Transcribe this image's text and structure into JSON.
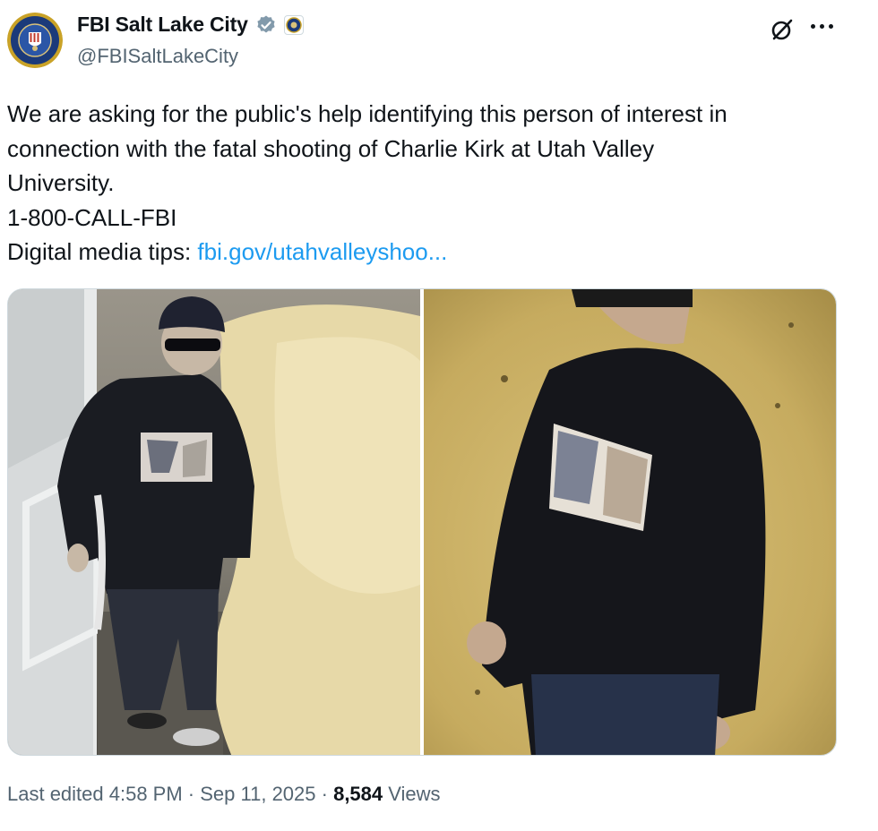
{
  "author": {
    "display_name": "FBI Salt Lake City",
    "handle": "@FBISaltLakeCity",
    "avatar_icon": "fbi-seal-icon",
    "verified_icon": "verified-badge-icon",
    "affiliation_icon": "fbi-affiliate-badge-icon"
  },
  "actions": {
    "grok_icon": "grok-icon",
    "more_icon": "more-options-icon"
  },
  "tweet": {
    "text_lines": [
      "We are asking for the public's help identifying this person of interest in",
      "connection with the fatal shooting of Charlie Kirk at Utah Valley",
      "University.",
      "1-800-CALL-FBI"
    ],
    "tips_prefix": "Digital media tips: ",
    "tips_link": "fbi.gov/utahvalleyshoo..."
  },
  "media": {
    "photos": [
      "surveillance-photo-stairwell",
      "surveillance-photo-hallway"
    ]
  },
  "footer": {
    "edited": "Last edited 4:58 PM",
    "sep1": " · ",
    "date": "Sep 11, 2025",
    "sep2": " · ",
    "views_count": "8,584",
    "views_label": " Views"
  },
  "colors": {
    "link": "#1d9bf0",
    "secondary_text": "#536471",
    "verified": "#829aab"
  }
}
